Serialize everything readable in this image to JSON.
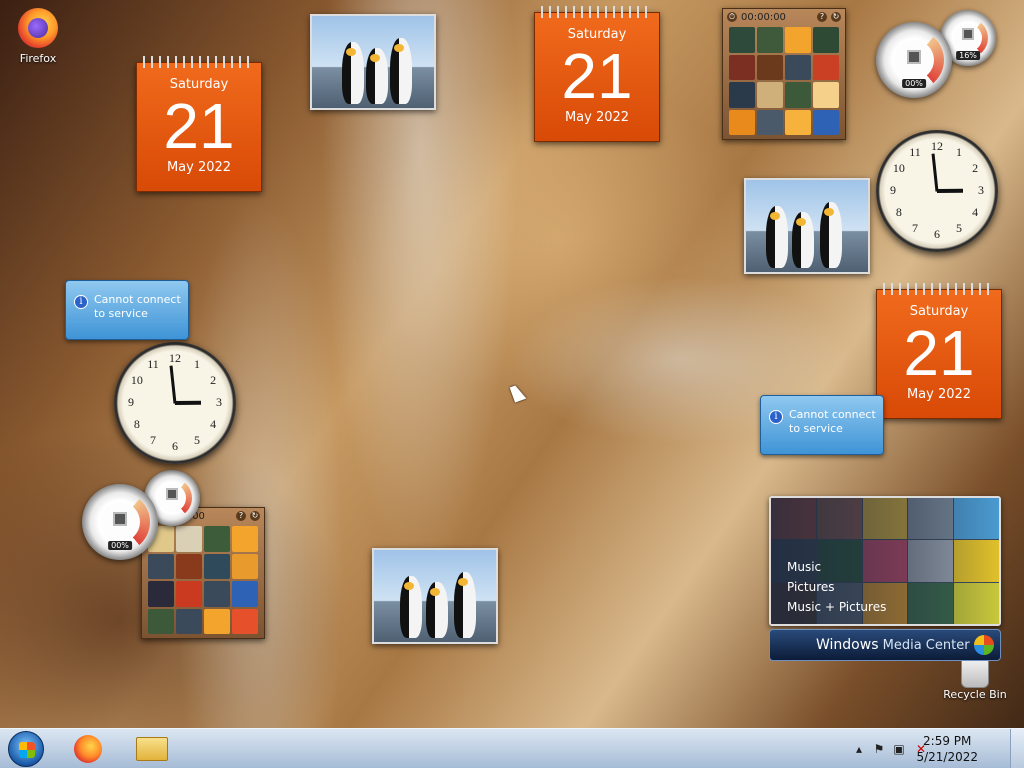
{
  "desktop": {
    "icons": {
      "firefox": "Firefox",
      "recycle_bin": "Recycle Bin"
    }
  },
  "calendar": {
    "weekday": "Saturday",
    "day": "21",
    "month_year": "May 2022"
  },
  "puzzle": {
    "timer": "00:00:00",
    "help": "?"
  },
  "meter": {
    "cpu": "00%",
    "memory": "16%"
  },
  "toast": {
    "message": "Cannot connect to service",
    "icon": "info-icon"
  },
  "clock": {
    "numerals": [
      "12",
      "1",
      "2",
      "3",
      "4",
      "5",
      "6",
      "7",
      "8",
      "9",
      "10",
      "11"
    ],
    "time": "2:59"
  },
  "media_center": {
    "options": [
      "Music",
      "Pictures",
      "Music + Pictures"
    ],
    "title_bold": "Windows",
    "title_rest": " Media Center"
  },
  "taskbar": {
    "time": "2:59 PM",
    "date": "5/21/2022",
    "tray_icons": [
      "show-hidden-icon",
      "action-center-flag-icon",
      "network-icon",
      "volume-muted-icon"
    ]
  },
  "colors": {
    "calendar_orange": "#e85a12",
    "toast_blue": "#3f94d6",
    "taskbar": "#b8cbe0"
  }
}
